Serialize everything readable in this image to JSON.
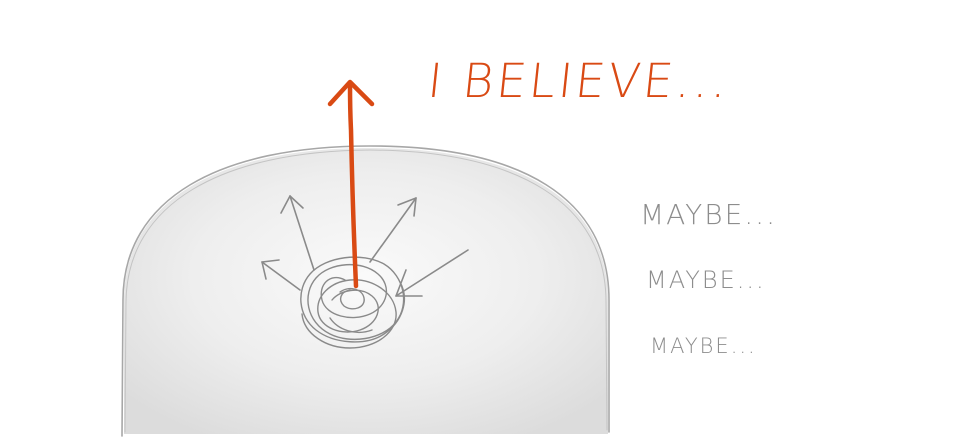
{
  "sketch": {
    "believe_text": "I BELIEVE...",
    "maybe_lines": [
      "MAYBE...",
      "MAYBE...",
      "MAYBE..."
    ]
  },
  "colors": {
    "accent": "#d94a14",
    "pencil": "#8d8d8d",
    "fill": "#ececec",
    "background": "#ffffff"
  },
  "icons": {
    "main_arrow": "up-arrow-icon",
    "scattered_arrows": "arrow-icon",
    "tangle": "scribble-icon"
  }
}
